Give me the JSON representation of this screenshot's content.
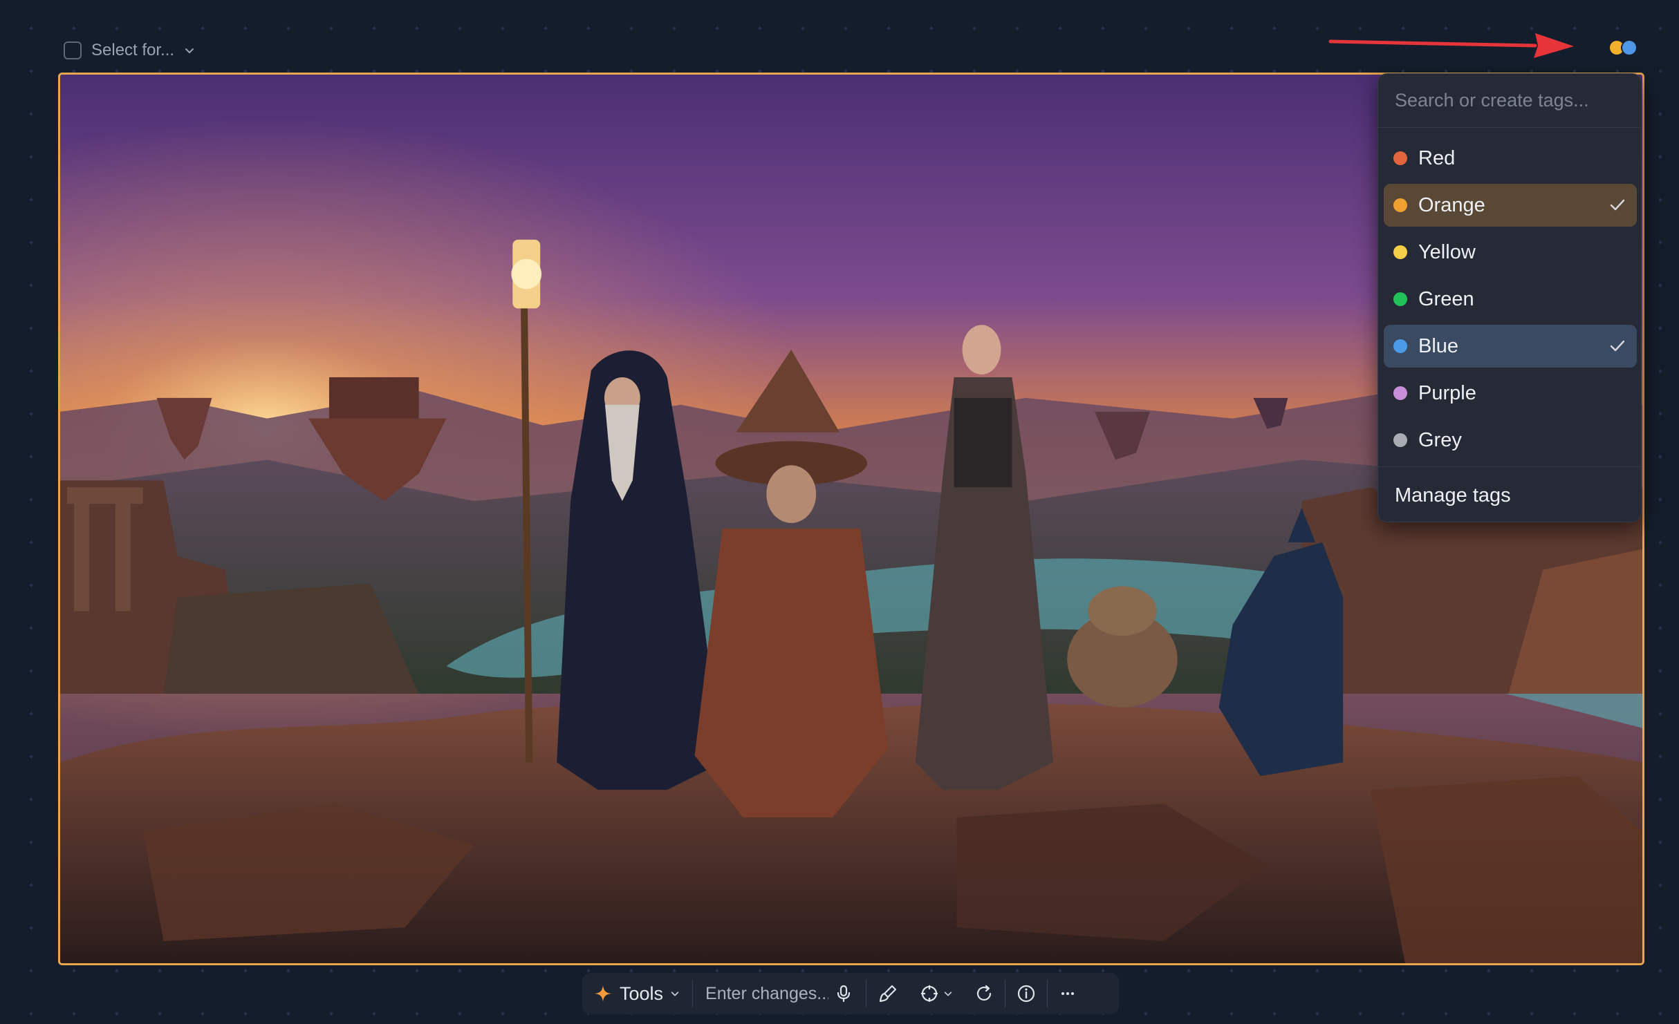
{
  "top_bar": {
    "select_label": "Select for...",
    "tag_indicator_colors": [
      "#f2b02c",
      "#4f97e6"
    ]
  },
  "tag_menu": {
    "search_placeholder": "Search or create tags...",
    "tags": [
      {
        "label": "Red",
        "color": "#e2653e",
        "selected": false
      },
      {
        "label": "Orange",
        "color": "#f0a030",
        "selected": true
      },
      {
        "label": "Yellow",
        "color": "#f5cf47",
        "selected": false
      },
      {
        "label": "Green",
        "color": "#22c25a",
        "selected": false
      },
      {
        "label": "Blue",
        "color": "#4c9be8",
        "selected": true
      },
      {
        "label": "Purple",
        "color": "#c98ed8",
        "selected": false
      },
      {
        "label": "Grey",
        "color": "#a9adb3",
        "selected": false
      }
    ],
    "manage_label": "Manage tags"
  },
  "toolbar": {
    "tools_label": "Tools",
    "changes_placeholder": "Enter changes..."
  },
  "colors": {
    "frame_border": "#e8a64f",
    "annotation_arrow": "#e5343a"
  }
}
